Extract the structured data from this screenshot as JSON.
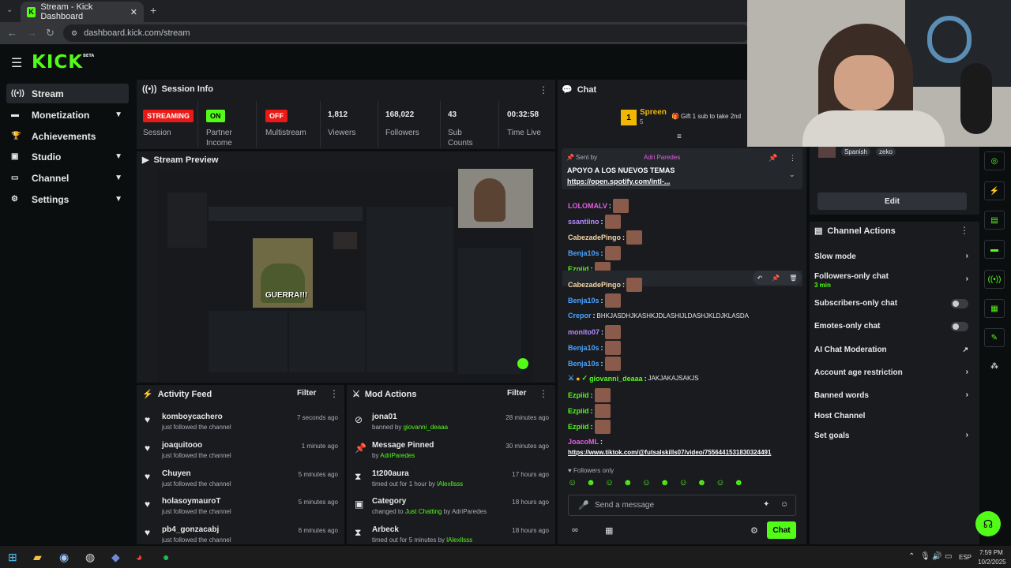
{
  "browser": {
    "tab_title": "Stream - Kick Dashboard",
    "new_tab": "+",
    "url": "dashboard.kick.com/stream"
  },
  "app": {
    "logo": "KICK",
    "logo_tag": "BETA"
  },
  "sidebar": {
    "items": [
      {
        "label": "Stream",
        "icon": "broadcast-icon"
      },
      {
        "label": "Monetization",
        "icon": "dollar-icon"
      },
      {
        "label": "Achievements",
        "icon": "trophy-icon"
      },
      {
        "label": "Studio",
        "icon": "studio-icon"
      },
      {
        "label": "Channel",
        "icon": "channel-icon"
      },
      {
        "label": "Settings",
        "icon": "gear-icon"
      }
    ]
  },
  "session": {
    "title": "Session Info",
    "status_badge": "STREAMING",
    "status_label": "Session",
    "partner_badge": "ON",
    "partner_label": "Partner Income",
    "multistream_badge": "OFF",
    "multistream_label": "Multistream",
    "viewers": "1,812",
    "viewers_label": "Viewers",
    "followers": "168,022",
    "followers_label": "Followers",
    "subs": "43",
    "subs_label": "Sub Counts",
    "time": "00:32:58",
    "time_label": "Time Live"
  },
  "preview": {
    "title": "Stream Preview",
    "overlay_text": "GUERRA!!!"
  },
  "activity": {
    "title": "Activity Feed",
    "filter": "Filter",
    "items": [
      {
        "name": "komboycachero",
        "sub": "just followed the channel",
        "time": "7 seconds ago"
      },
      {
        "name": "joaquitooo",
        "sub": "just followed the channel",
        "time": "1 minute ago"
      },
      {
        "name": "Chuyen",
        "sub": "just followed the channel",
        "time": "5 minutes ago"
      },
      {
        "name": "holasoymauroT",
        "sub": "just followed the channel",
        "time": "5 minutes ago"
      },
      {
        "name": "pb4_gonzacabj",
        "sub": "just followed the channel",
        "time": "6 minutes ago"
      }
    ]
  },
  "mod": {
    "title": "Mod Actions",
    "filter": "Filter",
    "items": [
      {
        "name": "jona01",
        "pre": "banned by ",
        "actor": "giovanni_deaaa",
        "post": "",
        "time": "28 minutes ago",
        "icon": "ban-icon"
      },
      {
        "name": "Message Pinned",
        "pre": "by ",
        "actor": "AdriParedes",
        "post": "",
        "time": "30 minutes ago",
        "icon": "pin-icon"
      },
      {
        "name": "1t200aura",
        "pre": "timed out for 1 hour by ",
        "actor": "lAlexllsss",
        "post": "",
        "time": "17 hours ago",
        "icon": "hourglass-icon"
      },
      {
        "name": "Category",
        "pre": "changed to ",
        "actor": "Just Chatting",
        "post": " by AdriParedes",
        "time": "18 hours ago",
        "icon": "category-icon"
      },
      {
        "name": "Arbeck",
        "pre": "timed out for 5 minutes by ",
        "actor": "lAlexllsss",
        "post": "",
        "time": "18 hours ago",
        "icon": "hourglass-icon"
      }
    ]
  },
  "chat": {
    "title": "Chat",
    "gifter_name": "Spreen",
    "gifter_count": "5",
    "gift_text": "Gift 1 sub to take 2nd",
    "pinned_by": "Sent by",
    "pinned_author": "Adri Paredes",
    "pinned_text": "APOYO A LOS NUEVOS TEMAS",
    "pinned_link": "https://open.spotify.com/intl-...",
    "messages": [
      {
        "user": "LOLOMALV",
        "text": "",
        "color": "#e060e0"
      },
      {
        "user": "ssantiino",
        "text": "",
        "color": "#b48cff"
      },
      {
        "user": "CabezadePingo",
        "text": "",
        "color": "#f4d4a4"
      },
      {
        "user": "Benja10s",
        "text": "",
        "color": "#4aa3ff"
      },
      {
        "user": "Ezpiid",
        "text": "",
        "color": "#53fc18"
      },
      {
        "user": "CabezadePingo",
        "text": "",
        "color": "#f4d4a4"
      },
      {
        "user": "Benja10s",
        "text": "",
        "color": "#4aa3ff"
      },
      {
        "user": "Crepor",
        "text": "BHKJASDHJKASHKJDLASHIJLDASHJKLDJKLASDA",
        "color": "#4aa3ff"
      },
      {
        "user": "monito07",
        "text": "",
        "color": "#b48cff"
      },
      {
        "user": "Benja10s",
        "text": "",
        "color": "#4aa3ff"
      },
      {
        "user": "Benja10s",
        "text": "",
        "color": "#4aa3ff"
      },
      {
        "user": "giovanni_deaaa",
        "text": "JAKJAKAJSAKJS",
        "color": "#53fc18"
      },
      {
        "user": "Ezpiid",
        "text": "",
        "color": "#53fc18"
      },
      {
        "user": "Ezpiid",
        "text": "",
        "color": "#53fc18"
      },
      {
        "user": "Ezpiid",
        "text": "",
        "color": "#53fc18"
      },
      {
        "user": "JoacoML",
        "text": "",
        "color": "#e060e0"
      }
    ],
    "last_link": "https://www.tiktok.com/@futsalskills07/video/7556441531830324491",
    "followers_only": "Followers only",
    "send_placeholder": "Send a message",
    "chat_button": "Chat"
  },
  "channel_info": {
    "tags": [
      "Spanish",
      "zeko"
    ],
    "edit": "Edit"
  },
  "channel_actions": {
    "title": "Channel Actions",
    "items": [
      {
        "label": "Slow mode",
        "control": "chevron"
      },
      {
        "label": "Followers-only chat",
        "sub": "3 min",
        "control": "chevron"
      },
      {
        "label": "Subscribers-only chat",
        "control": "toggle"
      },
      {
        "label": "Emotes-only chat",
        "control": "toggle"
      },
      {
        "label": "AI Chat Moderation",
        "control": "external"
      },
      {
        "label": "Account age restriction",
        "control": "chevron"
      },
      {
        "label": "Banned words",
        "control": "chevron"
      },
      {
        "label": "Host Channel",
        "control": "none"
      },
      {
        "label": "Set goals",
        "control": "chevron"
      }
    ]
  },
  "taskbar": {
    "time": "7:59 PM",
    "date": "10/2/2025",
    "lang": "ESP"
  }
}
